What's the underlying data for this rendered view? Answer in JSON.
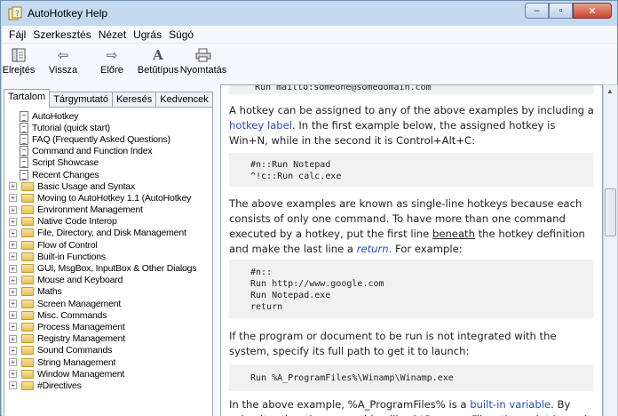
{
  "window": {
    "title": "AutoHotkey Help"
  },
  "caption_buttons": {
    "minimize": "–",
    "maximize": "▫",
    "close": "✕"
  },
  "menu": [
    {
      "label": "Fájl"
    },
    {
      "label": "Szerkesztés"
    },
    {
      "label": "Nézet"
    },
    {
      "label": "Ugrás"
    },
    {
      "label": "Súgó"
    }
  ],
  "toolbar": {
    "hide": "Elrejtés",
    "back": "Vissza",
    "forward": "Előre",
    "font": "Betűtípus",
    "print": "Nyomtatás"
  },
  "tabs": [
    "Tartalom",
    "Tárgymutató",
    "Keresés",
    "Kedvencek"
  ],
  "tree": [
    {
      "type": "doc",
      "label": "AutoHotkey"
    },
    {
      "type": "doc",
      "label": "Tutorial (quick start)"
    },
    {
      "type": "doc",
      "label": "FAQ (Frequently Asked Questions)"
    },
    {
      "type": "doc",
      "label": "Command and Function Index"
    },
    {
      "type": "doc",
      "label": "Script Showcase"
    },
    {
      "type": "doc",
      "label": "Recent Changes"
    },
    {
      "type": "folder",
      "label": "Basic Usage and Syntax"
    },
    {
      "type": "folder",
      "label": "Moving to AutoHotkey 1.1 (AutoHotkey"
    },
    {
      "type": "folder",
      "label": "Environment Management"
    },
    {
      "type": "folder",
      "label": "Native Code Interop"
    },
    {
      "type": "folder",
      "label": "File, Directory, and Disk Management"
    },
    {
      "type": "folder",
      "label": "Flow of Control"
    },
    {
      "type": "folder",
      "label": "Built-in Functions"
    },
    {
      "type": "folder",
      "label": "GUI, MsgBox, InputBox & Other Dialogs"
    },
    {
      "type": "folder",
      "label": "Mouse and Keyboard"
    },
    {
      "type": "folder",
      "label": "Maths"
    },
    {
      "type": "folder",
      "label": "Screen Management"
    },
    {
      "type": "folder",
      "label": "Misc. Commands"
    },
    {
      "type": "folder",
      "label": "Process Management"
    },
    {
      "type": "folder",
      "label": "Registry Management"
    },
    {
      "type": "folder",
      "label": "Sound Commands"
    },
    {
      "type": "folder",
      "label": "String Management"
    },
    {
      "type": "folder",
      "label": "Window Management"
    },
    {
      "type": "folder",
      "label": "#Directives"
    }
  ],
  "content": {
    "top_code": "Run mailto:someone@somedomain.com",
    "p1_a": "A hotkey can be assigned to any of the above examples by including a ",
    "p1_link": "hotkey label",
    "p1_b": ". In the first example below, the assigned hotkey is Win+N, while in the second it is Control+Alt+C:",
    "code1": "#n::Run Notepad\n^!c::Run calc.exe",
    "p2_a": "The above examples are known as single-line hotkeys because each consists of only one command. To have more than one command executed by a hotkey, put the first line ",
    "p2_u": "beneath",
    "p2_b": " the hotkey definition and make the last line a ",
    "p2_link": "return",
    "p2_c": ". For example:",
    "code2": "#n::\nRun http://www.google.com\nRun Notepad.exe\nreturn",
    "p3": "If the program or document to be run is not integrated with the system, specify its full path to get it to launch:",
    "code3": "Run %A_ProgramFiles%\\Winamp\\Winamp.exe",
    "p4_a": "In the above example, %A_ProgramFiles% is a ",
    "p4_link": "built-in variable",
    "p4_b": ". By using it rather than something like C:\\Program Files, the script is made"
  },
  "colors": {
    "link": "#2a4cba",
    "code_bg": "#f1f1f1",
    "chrome": "#bcd3ea"
  }
}
